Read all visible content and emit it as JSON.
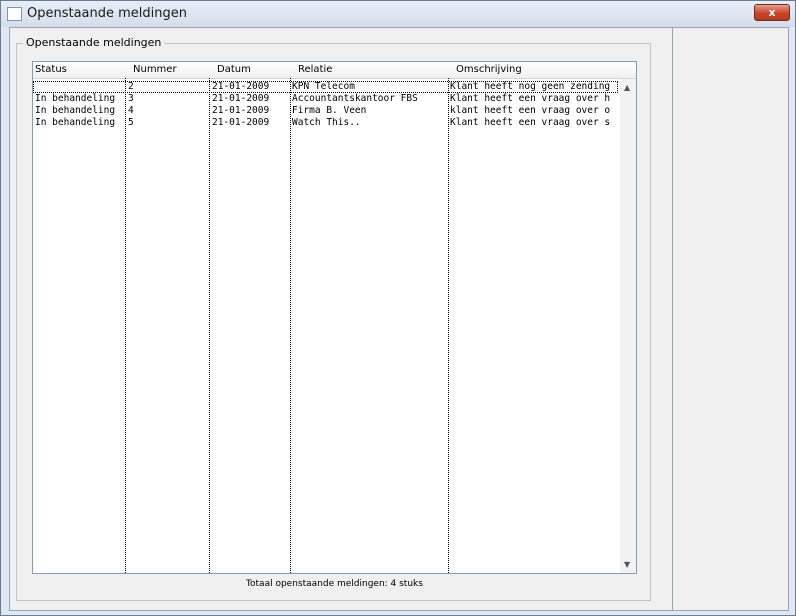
{
  "window": {
    "title": "Openstaande meldingen",
    "close_label": "x"
  },
  "group": {
    "label": "Openstaande meldingen"
  },
  "grid": {
    "columns": [
      "Status",
      "Nummer",
      "Datum",
      "Relatie",
      "Omschrijving"
    ],
    "rows": [
      [
        "",
        "2",
        "21-01-2009",
        "KPN Telecom",
        "Klant heeft nog geen zending"
      ],
      [
        "In behandeling",
        "3",
        "21-01-2009",
        "Accountantskantoor FBS",
        "Klant heeft een vraag over h"
      ],
      [
        "In behandeling",
        "4",
        "21-01-2009",
        "Firma B. Veen",
        "klant heeft een vraag over o"
      ],
      [
        "In behandeling",
        "5",
        "21-01-2009",
        "Watch This..",
        "Klant heeft een vraag over s"
      ]
    ]
  },
  "footer": {
    "text": "Totaal openstaande meldingen: 4 stuks"
  },
  "icons": {
    "scroll_up": "scroll-up-arrow-icon",
    "scroll_down": "scroll-down-arrow-icon"
  }
}
